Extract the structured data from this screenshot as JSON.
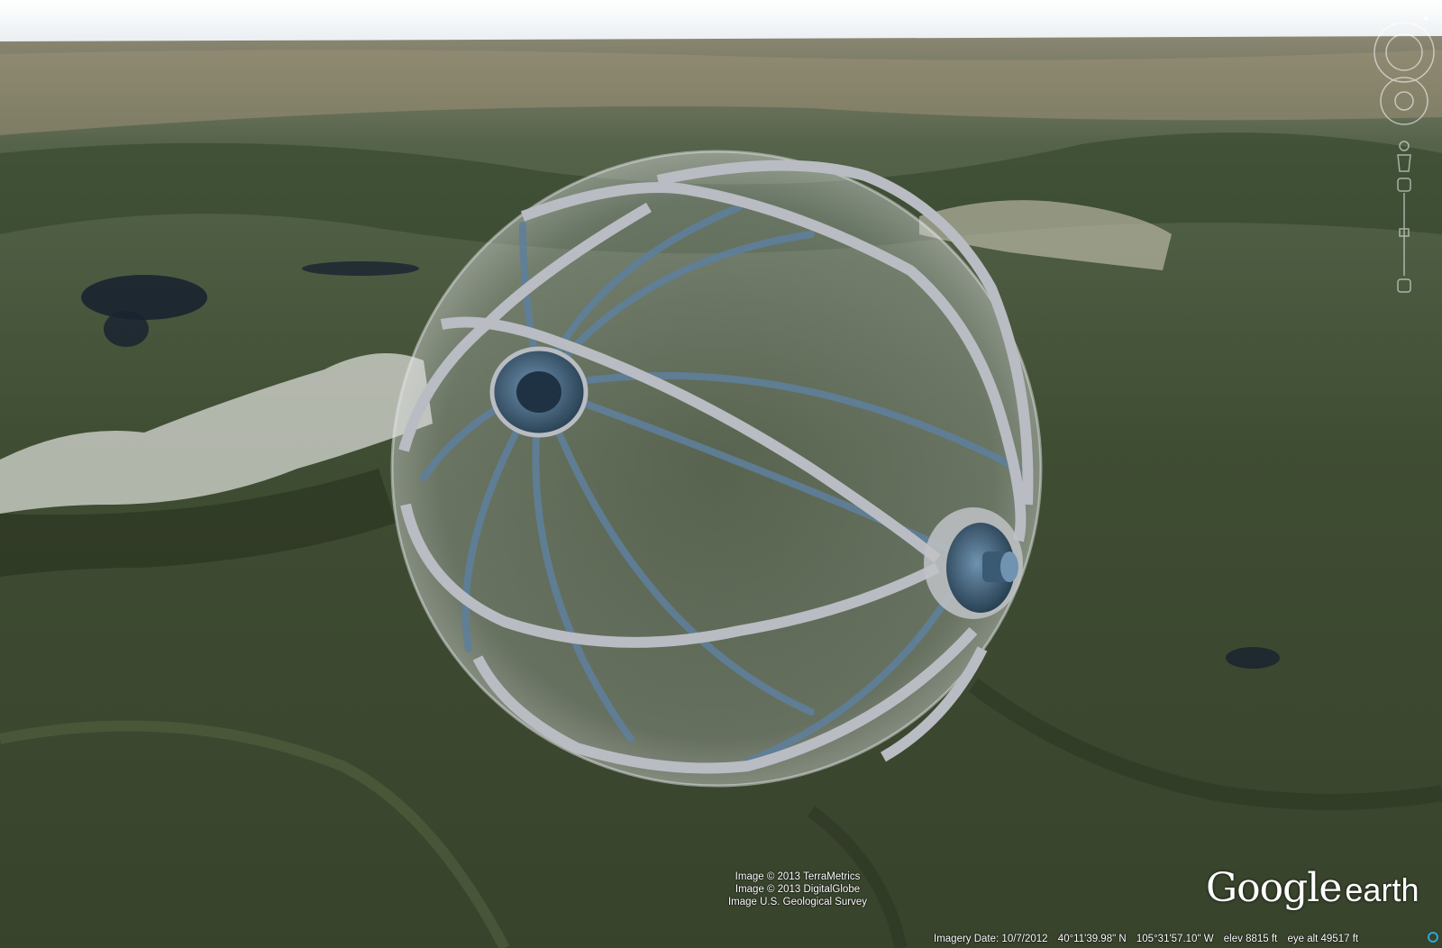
{
  "app": {
    "name": "Google Earth"
  },
  "map": {
    "model": "transparent spherical wheel frame model",
    "attribution": [
      "Image © 2013 TerraMetrics",
      "Image © 2013 DigitalGlobe",
      "Image U.S. Geological Survey"
    ]
  },
  "logo": {
    "word1": "Google",
    "word2": "earth"
  },
  "status": {
    "imagery_date": "Imagery Date: 10/7/2012",
    "lat": "40°11'39.98\" N",
    "lon": "105°31'57.10\" W",
    "elev": "elev  8815 ft",
    "eye_alt": "eye alt  49517 ft"
  },
  "icons": {
    "north": "north-arrow-icon",
    "look": "look-joystick-icon",
    "move": "move-joystick-icon",
    "streetview": "pegman-icon",
    "zoom": "zoom-slider-icon",
    "streaming": "streaming-status-icon"
  },
  "colors": {
    "sky": "#f4f7f9",
    "frame": "#b9bcc2",
    "spoke": "#5f7f9a",
    "hub": "#2f4d66"
  }
}
